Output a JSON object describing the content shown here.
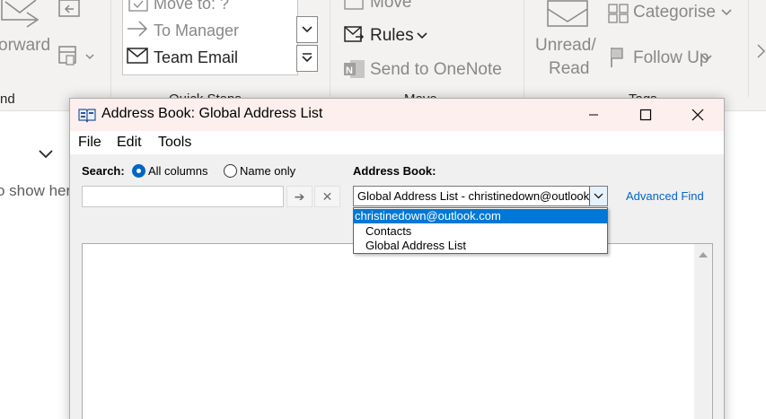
{
  "ribbon": {
    "forward_label": "orward",
    "move_to_label": "Move to: ?",
    "to_manager_label": "To Manager",
    "team_email_label": "Team Email",
    "quick_steps_label": "Quick Steps",
    "move_label": "Move",
    "rules_label": "Rules",
    "send_onenote_label": "Send to OneNote",
    "unread_read_line1": "Unread/",
    "unread_read_line2": "Read",
    "categorize_label": "Categorise",
    "follow_up_label": "Follow Up",
    "group_label_respond": "nd",
    "group_label_move": "Move",
    "group_label_tags": "Tags"
  },
  "background": {
    "hint_text": "o show her"
  },
  "dialog": {
    "title": "Address Book: Global Address List",
    "menu": [
      "File",
      "Edit",
      "Tools"
    ],
    "search_label": "Search:",
    "radio_all_columns": "All columns",
    "radio_name_only": "Name only",
    "search_value": "",
    "go_arrow": "➔",
    "clear_x": "✕",
    "address_book_label": "Address Book:",
    "address_book_selected": "Global Address List - christinedown@outlook.com",
    "advanced_find": "Advanced Find",
    "dropdown_options": [
      "christinedown@outlook.com",
      "Contacts",
      "Global Address List"
    ]
  },
  "colors": {
    "accent": "#0078d7",
    "title_bar": "#fcefee",
    "link": "#0066cc",
    "ribbon_bg": "#f3f2f1"
  },
  "icons": [
    "forward-icon",
    "calendar-icon",
    "move-to-icon",
    "arrow-right-icon",
    "mail-icon",
    "rules-icon",
    "onenote-icon",
    "envelope-icon",
    "categorize-icon",
    "flag-icon",
    "address-book-icon",
    "minimize-icon",
    "maximize-icon",
    "close-icon",
    "chevron-down-icon",
    "scroll-up-icon"
  ]
}
